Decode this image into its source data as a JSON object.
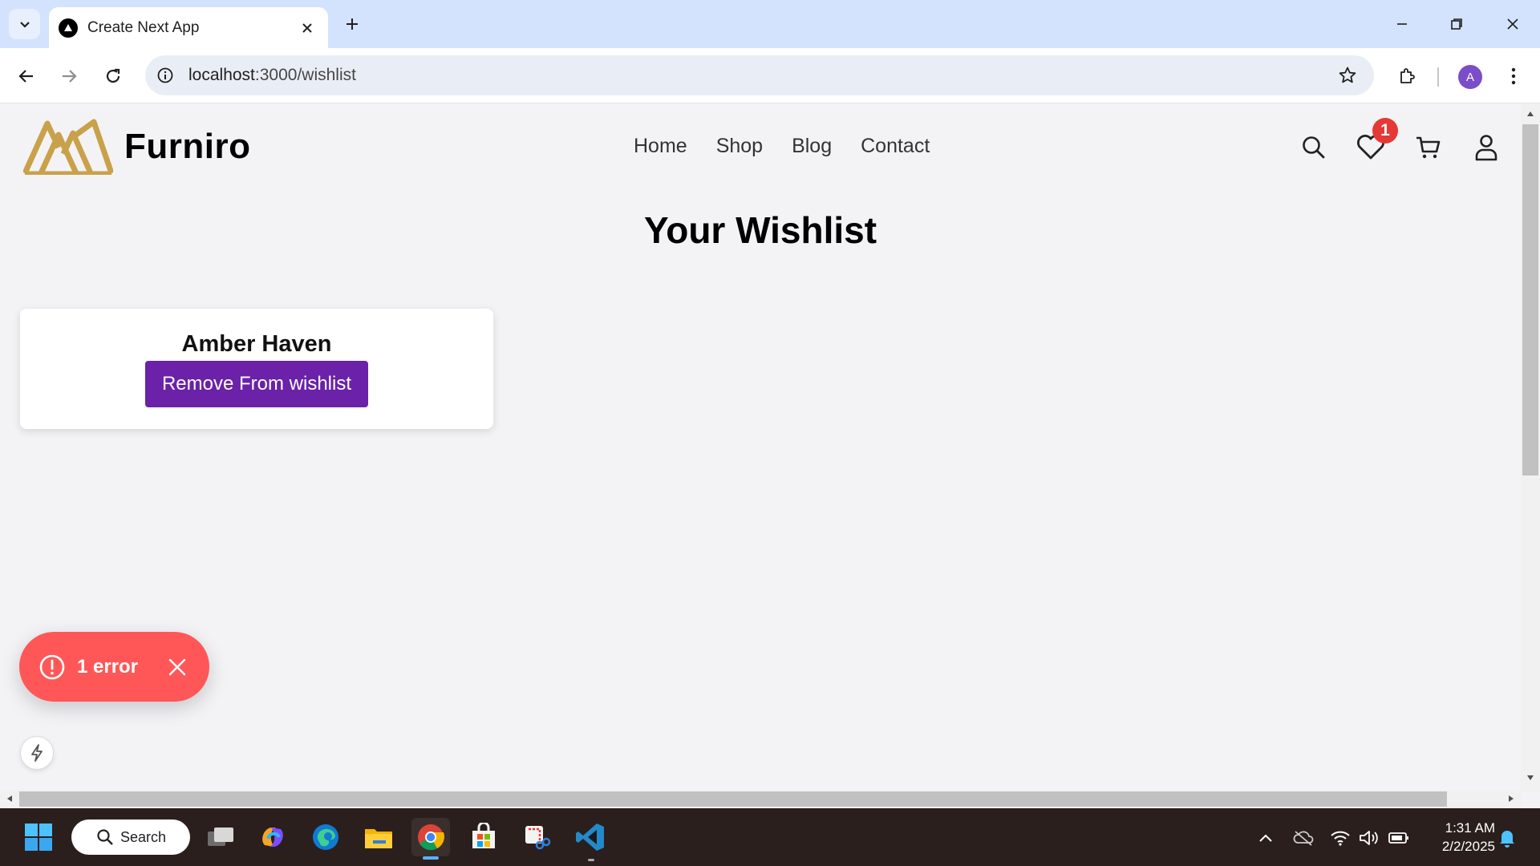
{
  "browser": {
    "tab_title": "Create Next App",
    "url_host": "localhost",
    "url_path": ":3000/wishlist",
    "profile_initial": "A"
  },
  "site": {
    "brand_name": "Furniro",
    "nav": [
      "Home",
      "Shop",
      "Blog",
      "Contact"
    ],
    "wishlist_count": "1",
    "page_title": "Your Wishlist",
    "item_name": "Amber Haven",
    "remove_label": "Remove From wishlist",
    "error_label": "1 error"
  },
  "taskbar": {
    "search_label": "Search",
    "time": "1:31 AM",
    "date": "2/2/2025"
  },
  "colors": {
    "brand_gold": "#c9a14a",
    "button_purple": "#6b21a8",
    "error_red": "#ff5757",
    "badge_red": "#e53935"
  }
}
